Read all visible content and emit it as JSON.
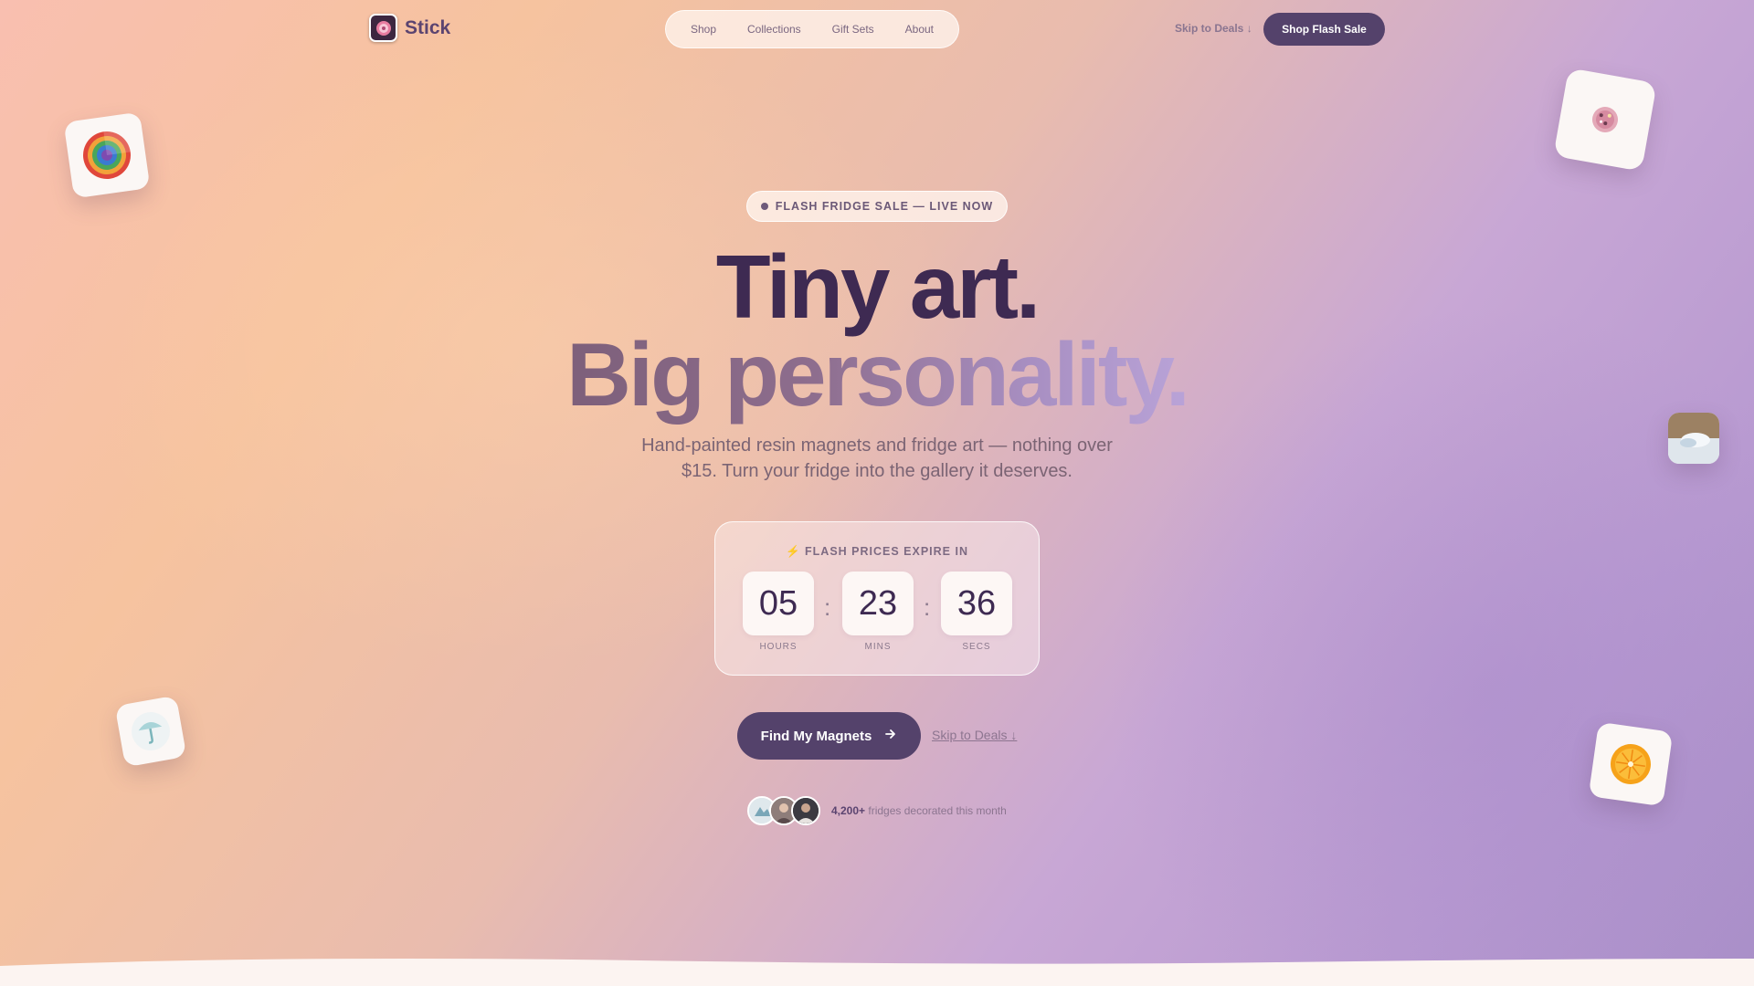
{
  "brand": {
    "name": "Stick",
    "icon": "magnet-swirl-logo"
  },
  "nav": {
    "links": [
      "Shop",
      "Collections",
      "Gift Sets",
      "About"
    ],
    "skip_label": "Skip to Deals ↓",
    "cta_label": "Shop Flash Sale"
  },
  "hero": {
    "badge": "FLASH FRIDGE SALE — LIVE NOW",
    "headline_line1": "Tiny art.",
    "headline_line2": "Big personality.",
    "subtitle": "Hand-painted resin magnets and fridge art — nothing over $15. Turn your fridge into the gallery it deserves."
  },
  "countdown": {
    "label": "⚡ FLASH PRICES EXPIRE IN",
    "hours": "05",
    "mins": "23",
    "secs": "36",
    "hours_label": "HOURS",
    "mins_label": "MINS",
    "secs_label": "SECS",
    "separator": ":"
  },
  "actions": {
    "primary_label": "Find My Magnets",
    "primary_icon": "arrow-right-icon",
    "secondary_label": "Skip to Deals ↓"
  },
  "social_proof": {
    "count": "4,200+",
    "text": "fridges decorated this month"
  },
  "colors": {
    "primary": "#54426b",
    "headline": "#3e2a52",
    "accent_gradient_end": "#b9a3d8"
  }
}
